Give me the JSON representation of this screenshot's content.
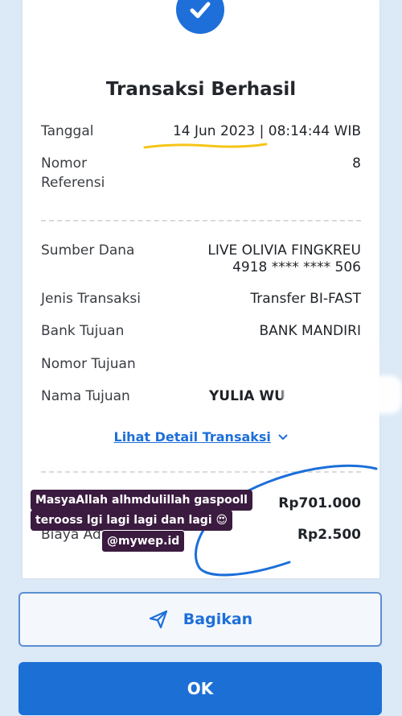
{
  "header": {
    "title": "Transaksi Berhasil"
  },
  "rows": {
    "tanggal": {
      "label": "Tanggal",
      "value": "14 Jun 2023 | 08:14:44 WIB"
    },
    "referensi": {
      "label": "Nomor Referensi",
      "label_line1": "Nomor",
      "label_line2": "Referensi",
      "value": "8"
    },
    "sumber": {
      "label": "Sumber Dana",
      "value_line1": "LIVE OLIVIA FINGKREU",
      "value_line2": "4918 **** **** 506"
    },
    "jenis": {
      "label": "Jenis Transaksi",
      "value": "Transfer BI-FAST"
    },
    "bank": {
      "label": "Bank Tujuan",
      "value": "BANK MANDIRI"
    },
    "nomor_tujuan": {
      "label": "Nomor Tujuan",
      "value": ""
    },
    "nama_tujuan": {
      "label": "Nama Tujuan",
      "value": "YULIA WU"
    }
  },
  "detail_link": {
    "label": "Lihat Detail Transaksi",
    "chevron": "⌄"
  },
  "amounts": {
    "nominal_value": "Rp701.000",
    "biaya_label": "Biaya Ad",
    "biaya_value": "Rp2.500"
  },
  "overlay": {
    "line1": "MasyaAllah alhmdulillah gaspooll",
    "line2": "terooss lgi lagi lagi dan lagi 😍",
    "handle": "@mywep.id"
  },
  "buttons": {
    "share": "Bagikan",
    "ok": "OK"
  },
  "colors": {
    "accent": "#1e6fd9",
    "background": "#dce9f7",
    "highlight": "#f5c518",
    "scribble": "#1b6fd9"
  },
  "icons": {
    "success": "check-icon",
    "share": "send-icon",
    "chevron": "chevron-down-icon"
  }
}
